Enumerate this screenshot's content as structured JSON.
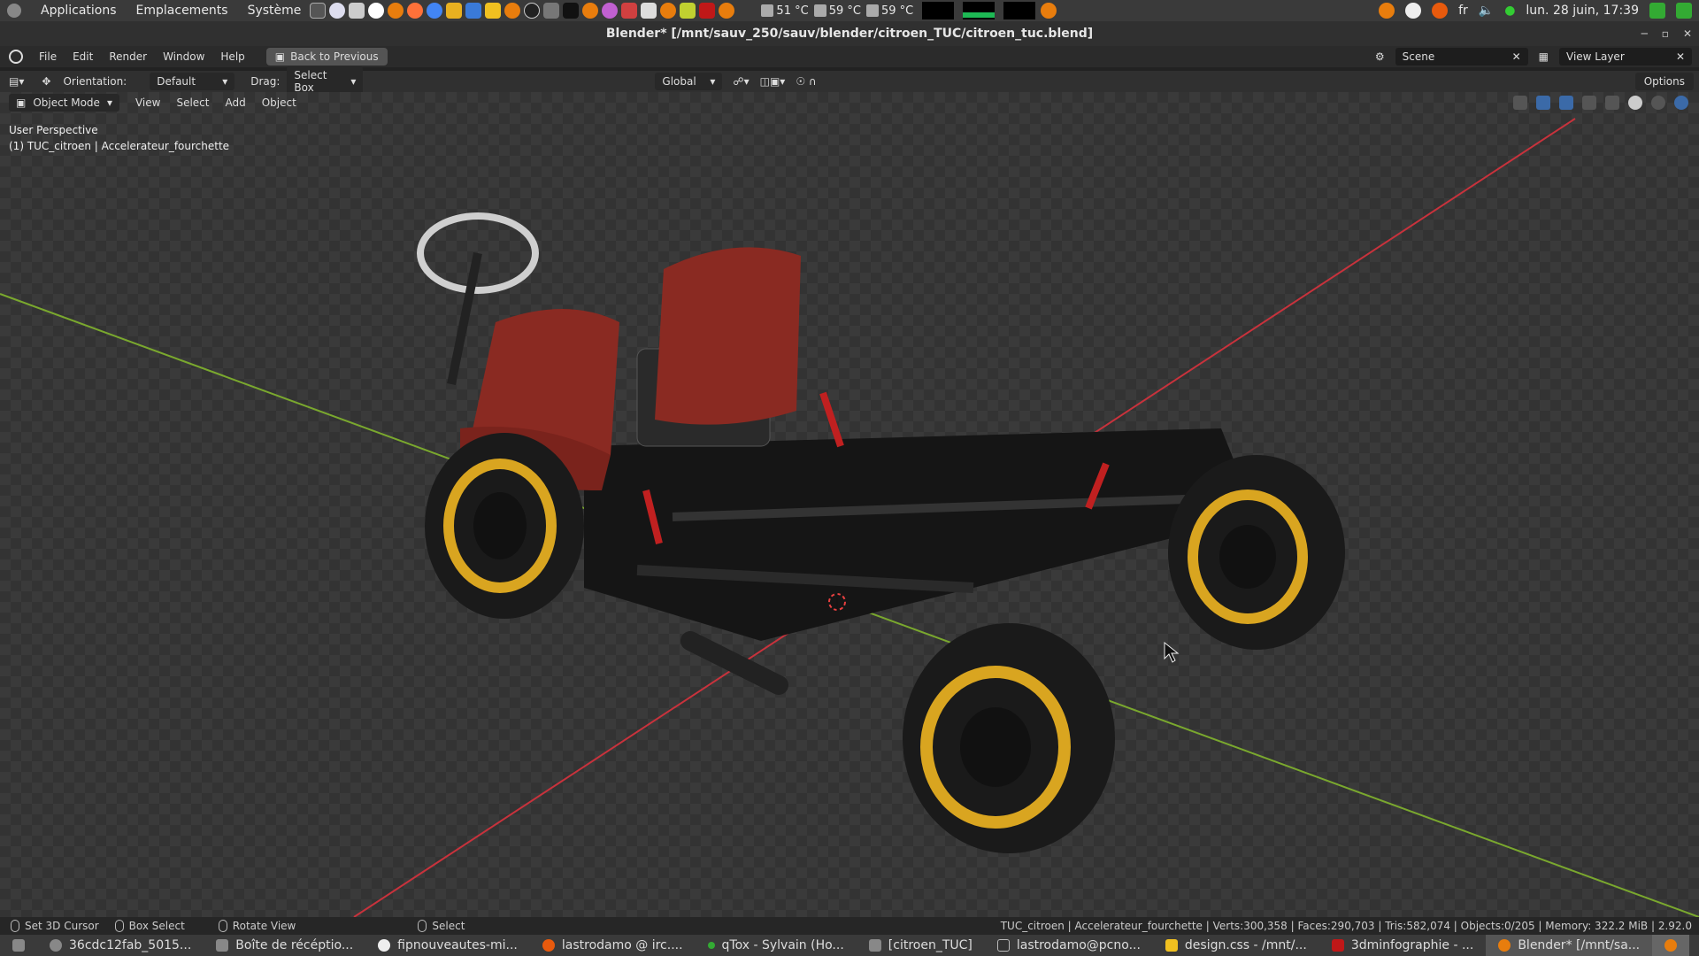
{
  "os_panel": {
    "menus": [
      "Applications",
      "Emplacements",
      "Système"
    ],
    "temps": [
      "51 °C",
      "59 °C",
      "59 °C"
    ],
    "lang": "fr",
    "datetime": "lun. 28 juin, 17:39"
  },
  "window": {
    "title": "Blender* [/mnt/sauv_250/sauv/blender/citroen_TUC/citroen_tuc.blend]"
  },
  "blender_top": {
    "menus": [
      "File",
      "Edit",
      "Render",
      "Window",
      "Help"
    ],
    "back_label": "Back to Previous",
    "scene": "Scene",
    "view_layer": "View Layer"
  },
  "header": {
    "orientation_label": "Orientation:",
    "orientation_value": "Default",
    "drag_label": "Drag:",
    "drag_value": "Select Box",
    "transform_orientation": "Global",
    "options_label": "Options"
  },
  "viewport": {
    "mode": "Object Mode",
    "menus": [
      "View",
      "Select",
      "Add",
      "Object"
    ],
    "perspective": "User Perspective",
    "active_object": "(1) TUC_citroen | Accelerateur_fourchette"
  },
  "statusbar": {
    "items": [
      "Set 3D Cursor",
      "Box Select",
      "Rotate View",
      "Select"
    ],
    "stats": "TUC_citroen | Accelerateur_fourchette | Verts:300,358 | Faces:290,703 | Tris:582,074 | Objects:0/205 | Memory: 322.2 MiB | 2.92.0"
  },
  "taskbar": {
    "tasks": [
      {
        "label": "36cdc12fab_5015..."
      },
      {
        "label": "Boîte de récéptio..."
      },
      {
        "label": "fipnouveautes-mi..."
      },
      {
        "label": "lastrodamo @ irc...."
      },
      {
        "label": "qTox - Sylvain (Ho..."
      },
      {
        "label": "[citroen_TUC]"
      },
      {
        "label": "lastrodamo@pcno..."
      },
      {
        "label": "design.css - /mnt/..."
      },
      {
        "label": "3dminfographie - ..."
      },
      {
        "label": "Blender* [/mnt/sa..."
      }
    ]
  },
  "colors": {
    "seat": "#8a2a22",
    "rim": "#d9a520",
    "x_axis": "#c8323c",
    "y_axis": "#7aa82e"
  }
}
